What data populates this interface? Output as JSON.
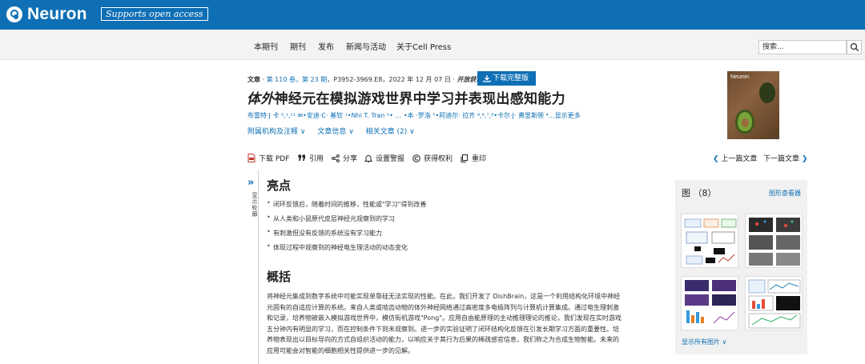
{
  "brand": {
    "logo_text": "Neuron",
    "open_access_badge": "Supports open access"
  },
  "nav": {
    "items": [
      "本期刊",
      "期刊",
      "发布",
      "新闻与活动",
      "关于Cell Press"
    ],
    "search_placeholder": "搜索..."
  },
  "article": {
    "meta": {
      "type": "文章",
      "volume_issue": "第 110 卷，第 23 期",
      "pages_date": "，P3952-3969.E8，2022 年 12 月 07 日 ·",
      "open_access": "开放获取"
    },
    "download_label": "下载完整版",
    "title_italic": "体外",
    "title_rest": "神经元在模拟游戏世界中学习并表现出感知能力",
    "authors": "布雷特·J 卡 ⁸,¹,¹¹ ✉•安迪·C· 基钦 ¹•Nhi T. Tran ²• … •本 ·罗洛 ⁵•阿迪尔· 拉齐 ⁴,⁶,⁷,⁸•卡尔·J· 弗里斯顿 ⁴…显示更多",
    "sub_links": [
      "附属机构及注释 ∨",
      "文章信息 ∨",
      "相关文章 (2) ∨"
    ]
  },
  "cover": {
    "title": "Neuron"
  },
  "toolbar": {
    "download_pdf": "下载 PDF",
    "cite": "引用",
    "share": "分享",
    "alert": "设置警报",
    "permissions": "获得权利",
    "reprint": "重印",
    "prev": "上一篇文章",
    "next": "下一篇文章"
  },
  "rail": {
    "label": "显示轮廓"
  },
  "highlights": {
    "heading": "亮点",
    "items": [
      "闭环反馈后，随着时间的推移，性能或\"学习\"得到改善",
      "从人类和小鼠原代皮层神经元观察到的学习",
      "有刺激但没有反馈的系统没有学习能力",
      "体现过程中观察到的神经电生理活动的动态变化"
    ]
  },
  "abstract": {
    "heading": "概括",
    "lines": [
      "将神经元集成到数字系统中可能实现单靠硅无法实现的性能。在此，我们开发了 DishBrain，这是一个利用结构化环境中神经",
      "元固有的自适应计算的系统。来自人类或啮齿动物的体外神经网络通过高密度多电极阵列与计算机计算集成。通过电生理刺激",
      "和记录，培养物被嵌入模拟游戏世界中，模仿街机游戏\"Pong\"。应用自由能原理的主动推理理论的推论，我们发现在实时游戏",
      "五分钟内有明显的学习，而在控制条件下则未观察到。进一步的实验证明了闭环结构化反馈在引发长期学习方面的重要性。培",
      "养物表现出以目标导向的方式自组织活动的能力，以响应关于其行为后果的稀疏感官信息，我们称之为合成生物智能。未来的",
      "应用可能会对智能的细胞相关性提供进一步的见解。"
    ]
  },
  "figures": {
    "title": "图 （8）",
    "viewer_link": "图形查看器",
    "show_all": "显示所有图片 ∨"
  }
}
